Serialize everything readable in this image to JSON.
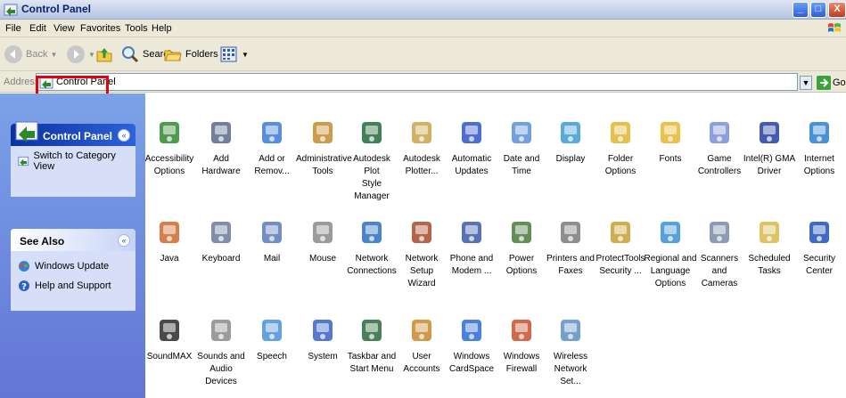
{
  "window": {
    "title": "Control Panel"
  },
  "menu": [
    "File",
    "Edit",
    "View",
    "Favorites",
    "Tools",
    "Help"
  ],
  "toolbar": {
    "back": "Back",
    "search": "Search",
    "folders": "Folders"
  },
  "address": {
    "label": "Address",
    "value": "Control Panel",
    "go": "Go"
  },
  "taskpane": {
    "control_panel": {
      "title": "Control Panel",
      "link": "Switch to Category View"
    },
    "see_also": {
      "title": "See Also",
      "links": [
        "Windows Update",
        "Help and Support"
      ]
    }
  },
  "items": [
    [
      "Accessibility",
      "Options"
    ],
    [
      "Add Hardware",
      ""
    ],
    [
      "Add or",
      "Remov..."
    ],
    [
      "Administrative",
      "Tools"
    ],
    [
      "Autodesk Plot",
      "Style Manager"
    ],
    [
      "Autodesk",
      "Plotter..."
    ],
    [
      "Automatic",
      "Updates"
    ],
    [
      "Date and Time",
      ""
    ],
    [
      "Display",
      ""
    ],
    [
      "Folder Options",
      ""
    ],
    [
      "Fonts",
      ""
    ],
    [
      "Game",
      "Controllers"
    ],
    [
      "Intel(R) GMA",
      "Driver"
    ],
    [
      "Internet",
      "Options"
    ],
    [
      "Java",
      ""
    ],
    [
      "Keyboard",
      ""
    ],
    [
      "Mail",
      ""
    ],
    [
      "Mouse",
      ""
    ],
    [
      "Network",
      "Connections"
    ],
    [
      "Network Setup",
      "Wizard"
    ],
    [
      "Phone and",
      "Modem ..."
    ],
    [
      "Power Options",
      ""
    ],
    [
      "Printers and",
      "Faxes"
    ],
    [
      "ProtectTools",
      "Security ..."
    ],
    [
      "Regional and",
      "Language",
      "Options"
    ],
    [
      "Scanners and",
      "Cameras"
    ],
    [
      "Scheduled",
      "Tasks"
    ],
    [
      "Security",
      "Center"
    ],
    [
      "SoundMAX",
      ""
    ],
    [
      "Sounds and",
      "Audio Devices"
    ],
    [
      "Speech",
      ""
    ],
    [
      "System",
      ""
    ],
    [
      "Taskbar and",
      "Start Menu"
    ],
    [
      "User Accounts",
      ""
    ],
    [
      "Windows",
      "CardSpace"
    ],
    [
      "Windows",
      "Firewall"
    ],
    [
      "Wireless",
      "Network Set..."
    ]
  ]
}
